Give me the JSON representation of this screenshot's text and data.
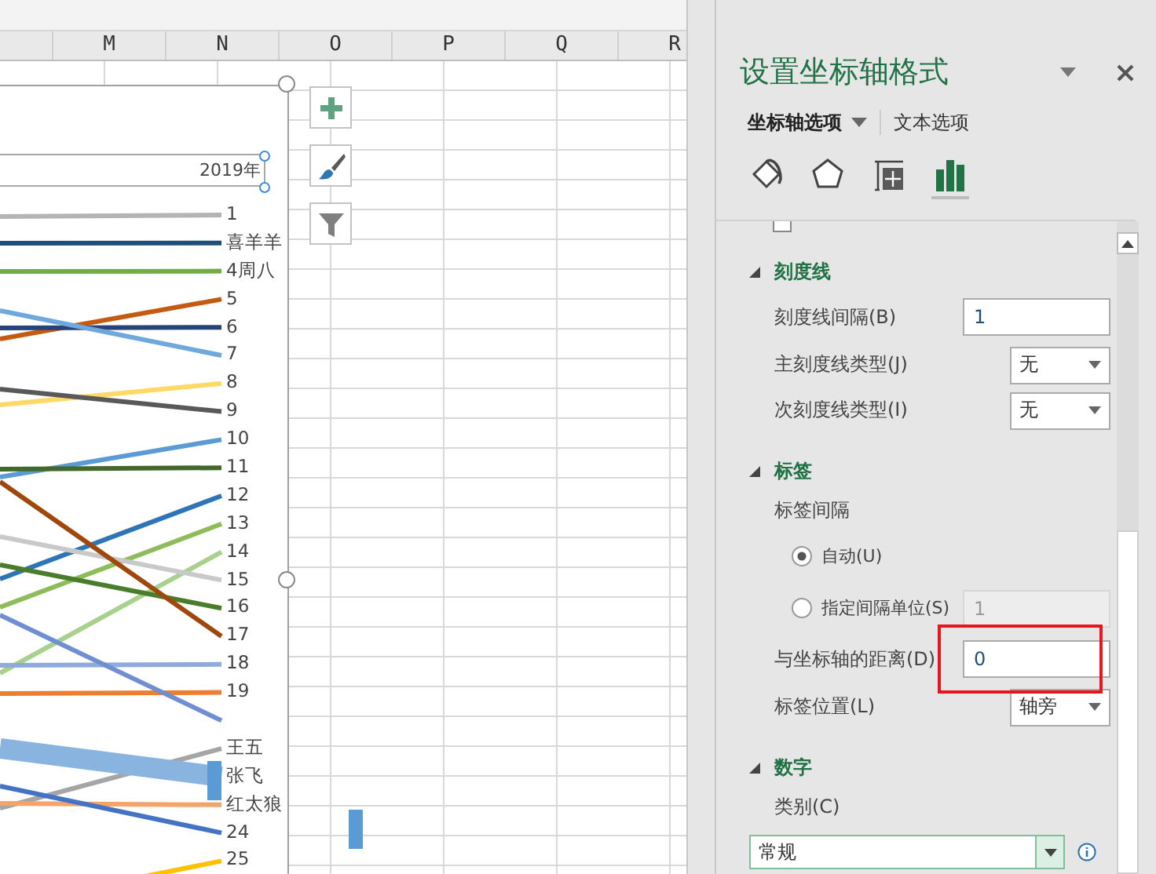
{
  "sheet": {
    "columns": [
      "M",
      "N",
      "O",
      "P",
      "Q",
      "R"
    ]
  },
  "chart": {
    "axis_title": "2019年",
    "series": [
      {
        "label": "1",
        "color": "#b4b4b4"
      },
      {
        "label": "喜羊羊",
        "color": "#1f4e79"
      },
      {
        "label": "4周八",
        "color": "#70ad47"
      },
      {
        "label": "5",
        "color": "#c55a11"
      },
      {
        "label": "6",
        "color": "#264478"
      },
      {
        "label": "7",
        "color": "#6fa8dc"
      },
      {
        "label": "8",
        "color": "#ffd966"
      },
      {
        "label": "9",
        "color": "#595959"
      },
      {
        "label": "10",
        "color": "#5b9bd5"
      },
      {
        "label": "11",
        "color": "#43682b"
      },
      {
        "label": "12",
        "color": "#2e75b6"
      },
      {
        "label": "13",
        "color": "#8fbc5a"
      },
      {
        "label": "14",
        "color": "#a9d18e"
      },
      {
        "label": "15",
        "color": "#c9c9c9"
      },
      {
        "label": "16",
        "color": "#4a7d2b"
      },
      {
        "label": "17",
        "color": "#9e480e"
      },
      {
        "label": "18",
        "color": "#8faadc"
      },
      {
        "label": "19",
        "color": "#ed7d31"
      },
      {
        "color": "#6f8fd0"
      },
      {
        "label": "王五",
        "color": "#a5a5a5"
      },
      {
        "label": "张飞",
        "color": "#8ab4e0",
        "kind": "band"
      },
      {
        "label": "红太狼",
        "color": "#f4a46b"
      },
      {
        "label": "24",
        "color": "#4472c4"
      },
      {
        "label": "25",
        "color": "#ffc000"
      }
    ]
  },
  "pane": {
    "title": "设置坐标轴格式",
    "tabs": [
      {
        "label": "坐标轴选项",
        "selected": true
      },
      {
        "label": "文本选项",
        "selected": false
      }
    ],
    "icon_tabs": [
      {
        "kind": "fill",
        "selected": false
      },
      {
        "kind": "effects",
        "selected": false
      },
      {
        "kind": "size",
        "selected": false
      },
      {
        "kind": "axis",
        "selected": true
      }
    ],
    "items": [
      {
        "kind": "checkbox",
        "checked": false
      },
      {
        "kind": "section",
        "label": "刻度线"
      },
      {
        "kind": "input",
        "label": "刻度线间隔(B)",
        "value": "1",
        "disabled": false
      },
      {
        "kind": "dropdown",
        "label": "主刻度线类型(J)",
        "value": "无"
      },
      {
        "kind": "dropdown",
        "label": "次刻度线类型(I)",
        "value": "无"
      },
      {
        "kind": "section",
        "label": "标签"
      },
      {
        "kind": "text",
        "label": "标签间隔"
      },
      {
        "kind": "radio",
        "label": "自动(U)",
        "selected": true
      },
      {
        "kind": "radio",
        "label": "指定间隔单位(S)",
        "selected": false,
        "value": "1",
        "disabled": true
      },
      {
        "kind": "input",
        "label": "与坐标轴的距离(D)",
        "value": "0",
        "disabled": false
      },
      {
        "kind": "dropdown",
        "label": "标签位置(L)",
        "value": "轴旁"
      },
      {
        "kind": "section",
        "label": "数字"
      },
      {
        "kind": "text",
        "label": "类别(C)"
      },
      {
        "kind": "wide-dropdown",
        "value": "常规"
      }
    ]
  }
}
